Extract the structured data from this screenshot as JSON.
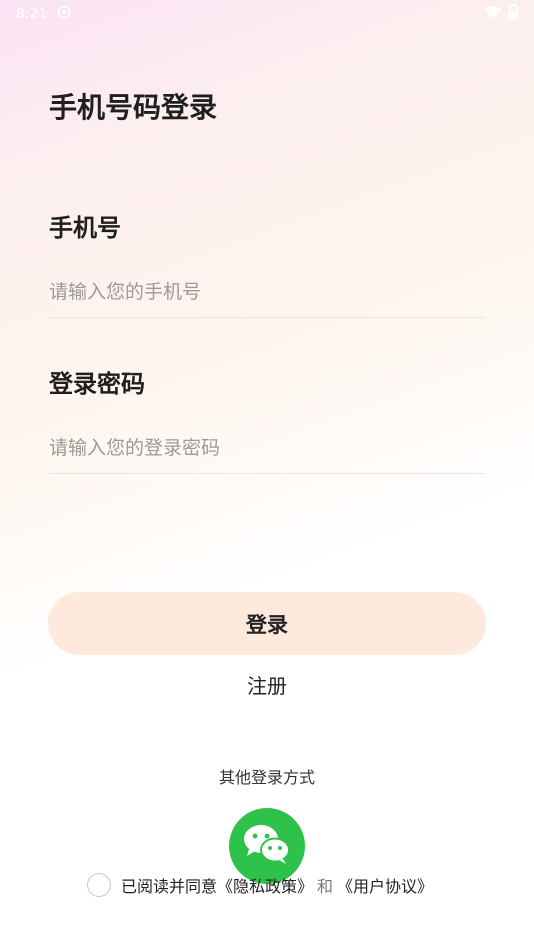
{
  "status_bar": {
    "time": "8:21"
  },
  "page": {
    "title": "手机号码登录"
  },
  "form": {
    "phone_label": "手机号",
    "phone_placeholder": "请输入您的手机号",
    "password_label": "登录密码",
    "password_placeholder": "请输入您的登录密码"
  },
  "actions": {
    "login_label": "登录",
    "register_label": "注册"
  },
  "other_login": {
    "label": "其他登录方式",
    "wechat_icon": "wechat-icon"
  },
  "agreement": {
    "prefix": "已阅读并同意",
    "privacy_policy": "《隐私政策》",
    "and": "和",
    "user_agreement": "《用户协议》"
  },
  "colors": {
    "login_button_bg": "#fdeadc",
    "wechat_green": "#2fc24a"
  }
}
